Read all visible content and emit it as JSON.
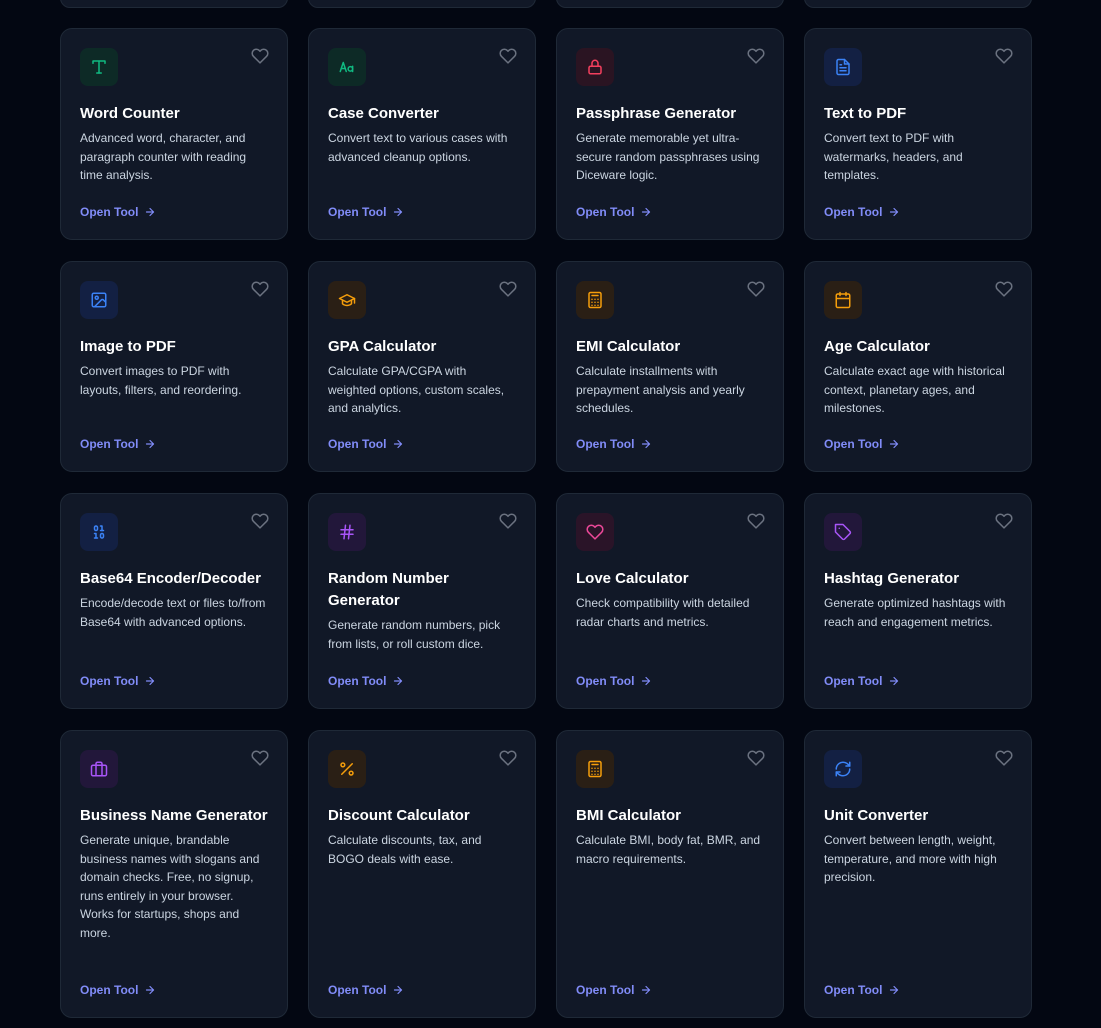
{
  "cards": [
    {
      "title": "Word Counter",
      "desc": "Advanced word, character, and paragraph counter with reading time analysis.",
      "icon": "text-type-icon",
      "color": "#10b981",
      "bg": "#0d2a26",
      "cta": "Open Tool"
    },
    {
      "title": "Case Converter",
      "desc": "Convert text to various cases with advanced cleanup options.",
      "icon": "case-aa-icon",
      "color": "#10b981",
      "bg": "#0d2a26",
      "cta": "Open Tool"
    },
    {
      "title": "Passphrase Generator",
      "desc": "Generate memorable yet ultra-secure random passphrases using Diceware logic.",
      "icon": "lock-icon",
      "color": "#f43f5e",
      "bg": "#2a1422",
      "cta": "Open Tool"
    },
    {
      "title": "Text to PDF",
      "desc": "Convert text to PDF with watermarks, headers, and templates.",
      "icon": "file-text-icon",
      "color": "#3b82f6",
      "bg": "#132043",
      "cta": "Open Tool"
    },
    {
      "title": "Image to PDF",
      "desc": "Convert images to PDF with layouts, filters, and reordering.",
      "icon": "image-icon",
      "color": "#3b82f6",
      "bg": "#132043",
      "cta": "Open Tool"
    },
    {
      "title": "GPA Calculator",
      "desc": "Calculate GPA/CGPA with weighted options, custom scales, and analytics.",
      "icon": "graduation-cap-icon",
      "color": "#f59e0b",
      "bg": "#2a1f15",
      "cta": "Open Tool"
    },
    {
      "title": "EMI Calculator",
      "desc": "Calculate installments with prepayment analysis and yearly schedules.",
      "icon": "calculator-icon",
      "color": "#f59e0b",
      "bg": "#2a1f15",
      "cta": "Open Tool"
    },
    {
      "title": "Age Calculator",
      "desc": "Calculate exact age with historical context, planetary ages, and milestones.",
      "icon": "calendar-icon",
      "color": "#f59e0b",
      "bg": "#2a1f15",
      "cta": "Open Tool"
    },
    {
      "title": "Base64 Encoder/Decoder",
      "desc": "Encode/decode text or files to/from Base64 with advanced options.",
      "icon": "binary-icon",
      "color": "#3b82f6",
      "bg": "#132043",
      "cta": "Open Tool"
    },
    {
      "title": "Random Number Generator",
      "desc": "Generate random numbers, pick from lists, or roll custom dice.",
      "icon": "hash-icon",
      "color": "#a855f7",
      "bg": "#22173a",
      "cta": "Open Tool"
    },
    {
      "title": "Love Calculator",
      "desc": "Check compatibility with detailed radar charts and metrics.",
      "icon": "heart-icon",
      "color": "#ec4899",
      "bg": "#2a1428",
      "cta": "Open Tool"
    },
    {
      "title": "Hashtag Generator",
      "desc": "Generate optimized hashtags with reach and engagement metrics.",
      "icon": "tag-icon",
      "color": "#a855f7",
      "bg": "#22173a",
      "cta": "Open Tool"
    },
    {
      "title": "Business Name Generator",
      "desc": "Generate unique, brandable business names with slogans and domain checks. Free, no signup, runs entirely in your browser. Works for startups, shops and more.",
      "icon": "briefcase-icon",
      "color": "#a855f7",
      "bg": "#22173a",
      "cta": "Open Tool"
    },
    {
      "title": "Discount Calculator",
      "desc": "Calculate discounts, tax, and BOGO deals with ease.",
      "icon": "percent-icon",
      "color": "#f59e0b",
      "bg": "#2a1f15",
      "cta": "Open Tool"
    },
    {
      "title": "BMI Calculator",
      "desc": "Calculate BMI, body fat, BMR, and macro requirements.",
      "icon": "calculator-icon",
      "color": "#f59e0b",
      "bg": "#2a1f15",
      "cta": "Open Tool"
    },
    {
      "title": "Unit Converter",
      "desc": "Convert between length, weight, temperature, and more with high precision.",
      "icon": "refresh-icon",
      "color": "#3b82f6",
      "bg": "#132043",
      "cta": "Open Tool"
    }
  ]
}
